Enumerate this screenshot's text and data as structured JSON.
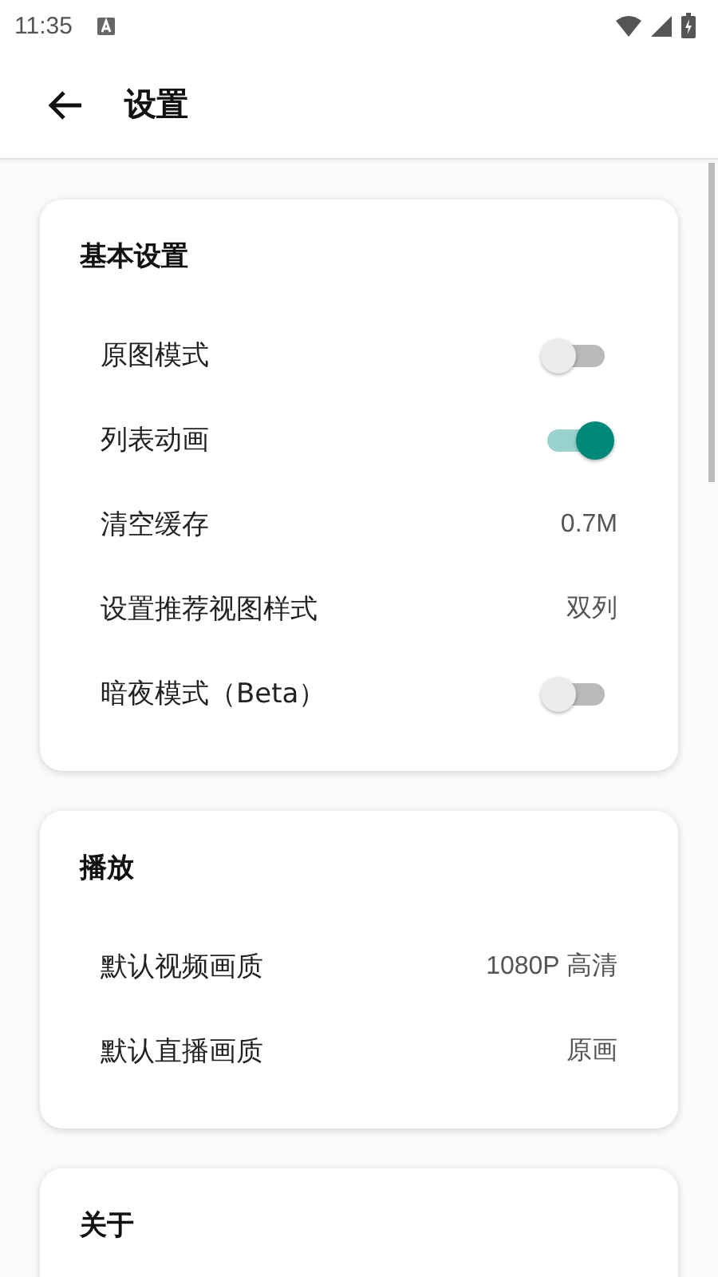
{
  "status_bar": {
    "time": "11:35"
  },
  "toolbar": {
    "title": "设置"
  },
  "sections": [
    {
      "title": "基本设置",
      "rows": [
        {
          "kind": "switch",
          "label": "原图模式",
          "on": false
        },
        {
          "kind": "switch",
          "label": "列表动画",
          "on": true
        },
        {
          "kind": "value",
          "label": "清空缓存",
          "value": "0.7M"
        },
        {
          "kind": "value",
          "label": "设置推荐视图样式",
          "value": "双列"
        },
        {
          "kind": "switch",
          "label": "暗夜模式（Beta）",
          "on": false
        }
      ]
    },
    {
      "title": "播放",
      "rows": [
        {
          "kind": "value",
          "label": "默认视频画质",
          "value": "1080P 高清"
        },
        {
          "kind": "value",
          "label": "默认直播画质",
          "value": "原画"
        }
      ]
    },
    {
      "title": "关于"
    }
  ]
}
